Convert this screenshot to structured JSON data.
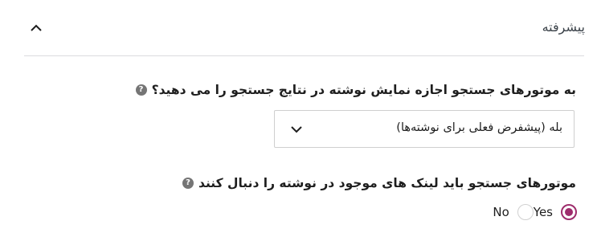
{
  "panel": {
    "title": "پیشرفته",
    "collapse_icon": "chevron-up-icon"
  },
  "question1": {
    "label": "به موتورهای جستجو اجازه نمایش نوشته در نتایج جستجو را می دهید؟",
    "help_icon": "help-icon",
    "help_glyph": "?",
    "select": {
      "selected": "بله (پیشفرض فعلی برای نوشته‌ها)",
      "icon": "chevron-down-icon"
    }
  },
  "question2": {
    "label": "موتورهای جستجو باید لینک های موجود در نوشته را دنبال کنند",
    "help_icon": "help-icon",
    "help_glyph": "?",
    "options": [
      {
        "label": "Yes",
        "checked": true
      },
      {
        "label": "No",
        "checked": false
      }
    ]
  },
  "colors": {
    "accent": "#9e2c6c",
    "divider": "#dcdcde",
    "help": "#757575"
  }
}
